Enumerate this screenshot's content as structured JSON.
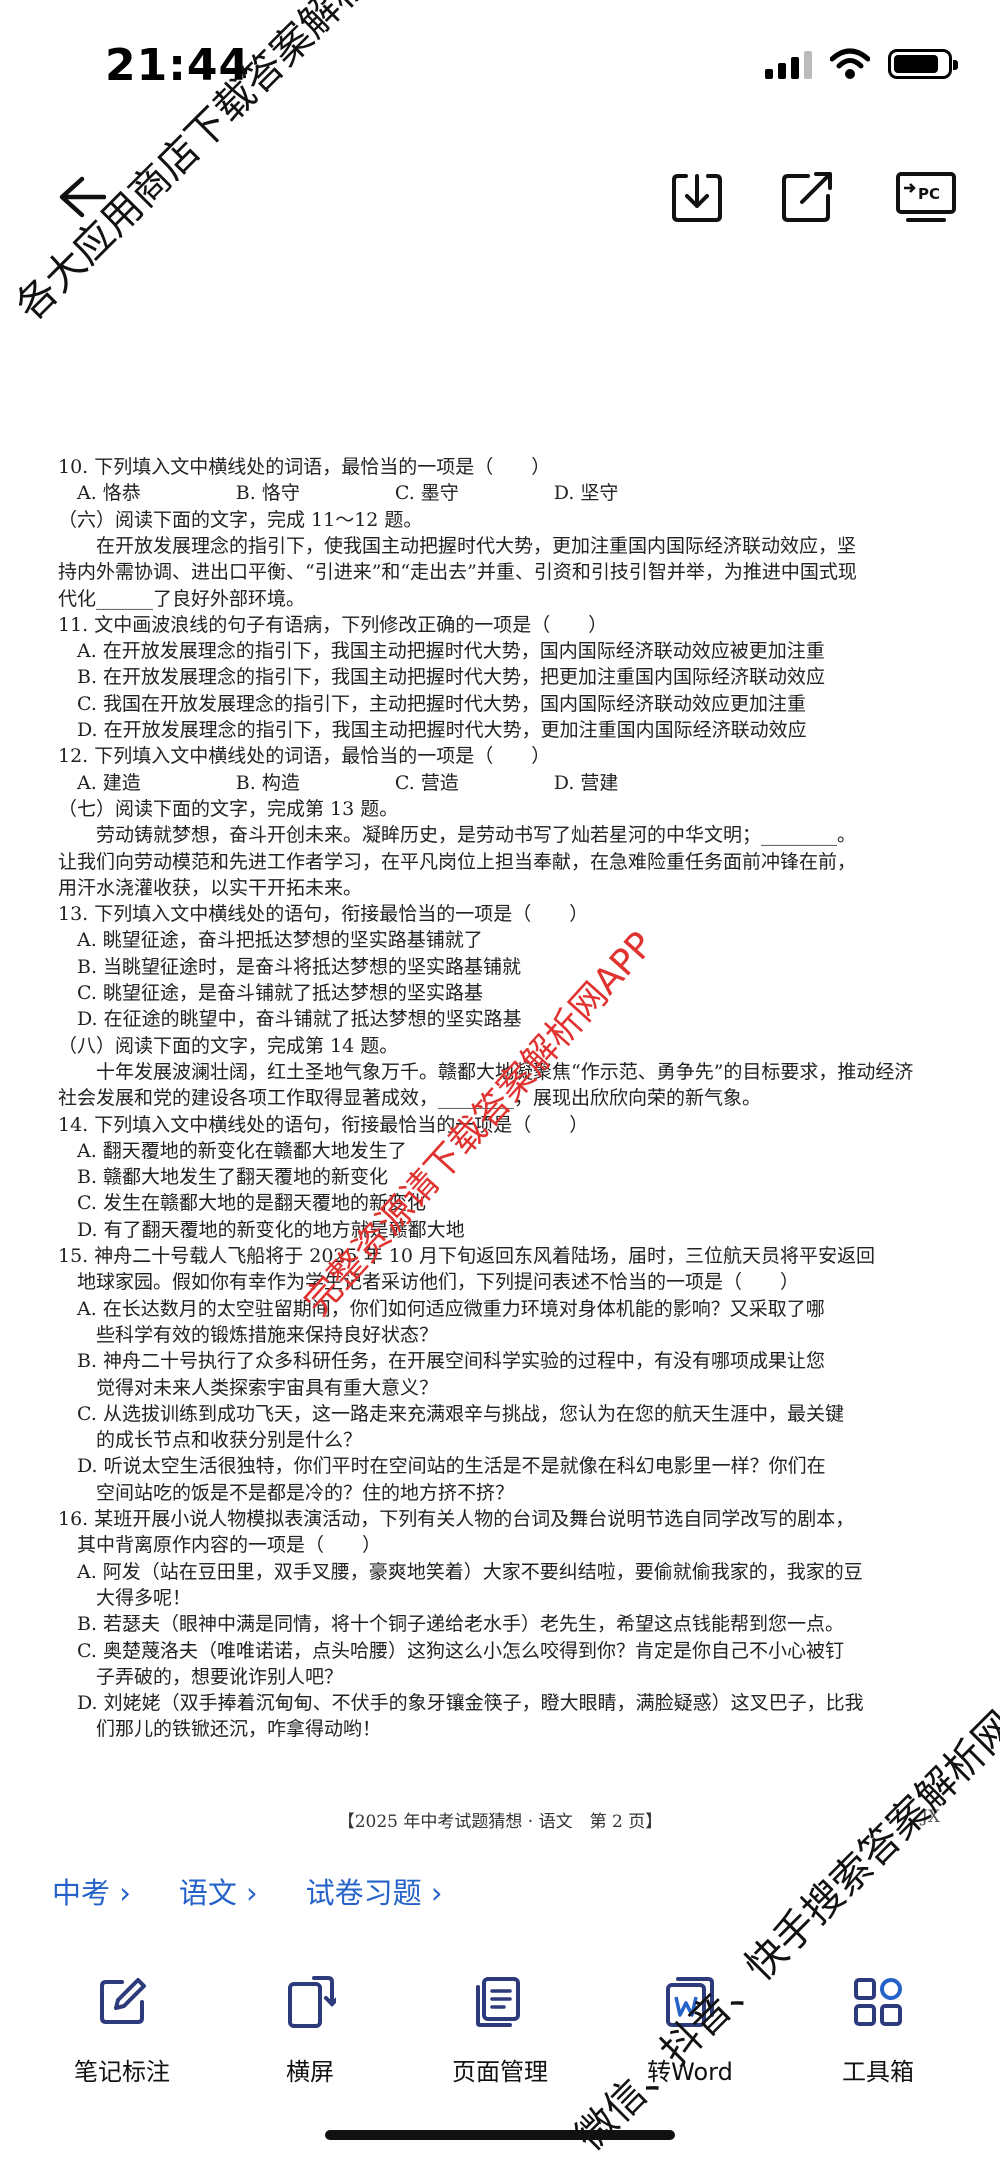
{
  "status_bar": {
    "time": "21:44"
  },
  "document": {
    "lines": [
      "10. 下列填入文中横线处的词语，最恰当的一项是（　　）",
      "　A. 恪恭　　　　　B. 恪守　　　　　C. 墨守　　　　　D. 坚守",
      "（六）阅读下面的文字，完成 11～12 题。",
      "　　在开放发展理念的指引下，使我国主动把握时代大势，更加注重国内国际经济联动效应，坚",
      "持内外需协调、进出口平衡、“引进来”和“走出去”并重、引资和引技引智并举，为推进中国式现",
      "代化______了良好外部环境。",
      "11. 文中画波浪线的句子有语病，下列修改正确的一项是（　　）",
      "　A. 在开放发展理念的指引下，我国主动把握时代大势，国内国际经济联动效应被更加注重",
      "　B. 在开放发展理念的指引下，我国主动把握时代大势，把更加注重国内国际经济联动效应",
      "　C. 我国在开放发展理念的指引下，主动把握时代大势，国内国际经济联动效应更加注重",
      "　D. 在开放发展理念的指引下，我国主动把握时代大势，更加注重国内国际经济联动效应",
      "12. 下列填入文中横线处的词语，最恰当的一项是（　　）",
      "　A. 建造　　　　　B. 构造　　　　　C. 营造　　　　　D. 营建",
      "（七）阅读下面的文字，完成第 13 题。",
      "　　劳动铸就梦想，奋斗开创未来。凝眸历史，是劳动书写了灿若星河的中华文明；________。",
      "让我们向劳动模范和先进工作者学习，在平凡岗位上担当奉献，在急难险重任务面前冲锋在前，",
      "用汗水浇灌收获，以实干开拓未来。",
      "13. 下列填入文中横线处的语句，衔接最恰当的一项是（　　）",
      "　A. 眺望征途，奋斗把抵达梦想的坚实路基铺就了",
      "　B. 当眺望征途时，是奋斗将抵达梦想的坚实路基铺就",
      "　C. 眺望征途，是奋斗铺就了抵达梦想的坚实路基",
      "　D. 在征途的眺望中，奋斗铺就了抵达梦想的坚实路基",
      "（八）阅读下面的文字，完成第 14 题。",
      "　　十年发展波澜壮阔，红土圣地气象万千。赣鄱大地凝聚焦“作示范、勇争先”的目标要求，推动经济",
      "社会发展和党的建设各项工作取得显著成效，________，展现出欣欣向荣的新气象。",
      "14. 下列填入文中横线处的语句，衔接最恰当的一项是（　　）",
      "　A. 翻天覆地的新变化在赣鄱大地发生了",
      "　B. 赣鄱大地发生了翻天覆地的新变化",
      "　C. 发生在赣鄱大地的是翻天覆地的新变化",
      "　D. 有了翻天覆地的新变化的地方就是赣鄱大地",
      "15. 神舟二十号载人飞船将于 2025 年 10 月下旬返回东风着陆场，届时，三位航天员将平安返回",
      "　地球家园。假如你有幸作为学生记者采访他们，下列提问表述不恰当的一项是（　　）",
      "　A. 在长达数月的太空驻留期间，你们如何适应微重力环境对身体机能的影响？又采取了哪",
      "　　些科学有效的锻炼措施来保持良好状态？",
      "　B. 神舟二十号执行了众多科研任务，在开展空间科学实验的过程中，有没有哪项成果让您",
      "　　觉得对未来人类探索宇宙具有重大意义？",
      "　C. 从选拔训练到成功飞天，这一路走来充满艰辛与挑战，您认为在您的航天生涯中，最关键",
      "　　的成长节点和收获分别是什么？",
      "　D. 听说太空生活很独特，你们平时在空间站的生活是不是就像在科幻电影里一样？你们在",
      "　　空间站吃的饭是不是都是冷的？住的地方挤不挤？",
      "16. 某班开展小说人物模拟表演活动，下列有关人物的台词及舞台说明节选自同学改写的剧本，",
      "　其中背离原作内容的一项是（　　）",
      "　A. 阿发（站在豆田里，双手叉腰，豪爽地笑着）大家不要纠结啦，要偷就偷我家的，我家的豆",
      "　　大得多呢！",
      "　B. 若瑟夫（眼神中满是同情，将十个铜子递给老水手）老先生，希望这点钱能帮到您一点。",
      "　C. 奥楚蔑洛夫（唯唯诺诺，点头哈腰）这狗这么小怎么咬得到你？肯定是你自己不小心被钉",
      "　　子弄破的，想要讹诈别人吧？",
      "　D. 刘姥姥（双手捧着沉甸甸、不伏手的象牙镶金筷子，瞪大眼睛，满脸疑惑）这叉巴子，比我",
      "　　们那儿的铁锨还沉，咋拿得动哟！"
    ],
    "footer": "【2025 年中考试题猜想 · 语文　第 2 页】",
    "footer_tag": "JX"
  },
  "breadcrumb": [
    "中考 ›",
    "语文 ›",
    "试卷习题 ›"
  ],
  "bottom_bar": {
    "items": [
      {
        "label": "笔记标注",
        "icon": "edit-icon"
      },
      {
        "label": "横屏",
        "icon": "rotate-icon"
      },
      {
        "label": "页面管理",
        "icon": "pages-icon"
      },
      {
        "label": "转Word",
        "icon": "word-icon"
      },
      {
        "label": "工具箱",
        "icon": "toolbox-icon"
      }
    ]
  },
  "watermarks": [
    "各大应用商店下载答案解析网APP",
    "完整资源请下载答案解析网APP",
    "微信、抖音、快手搜索答案解析网"
  ],
  "colors": {
    "link": "#2563c9",
    "watermark_red": "#e0322f"
  }
}
